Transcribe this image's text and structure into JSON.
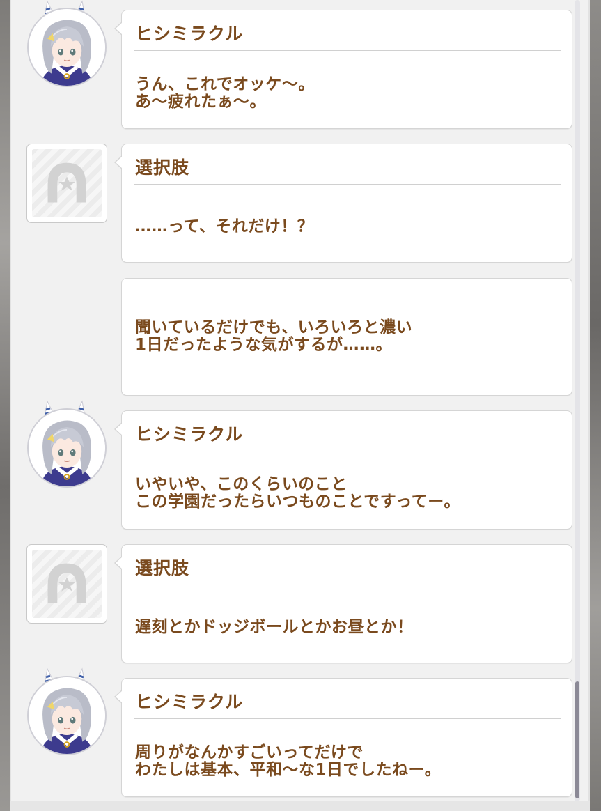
{
  "log": [
    {
      "type": "character",
      "speaker": "ヒシミラクル",
      "avatar_icon": "hishi-miracle-avatar-icon",
      "lines": "うん、これでオッケ～。\nあ～疲れたぁ～。"
    },
    {
      "type": "choice",
      "speaker": "選択肢",
      "avatar_icon": "horseshoe-star-icon",
      "lines": "……って、それだけ！？"
    },
    {
      "type": "narration",
      "speaker": "",
      "lines": "聞いているだけでも、いろいろと濃い\n1日だったような気がするが……。"
    },
    {
      "type": "character",
      "speaker": "ヒシミラクル",
      "avatar_icon": "hishi-miracle-avatar-icon",
      "lines": "いやいや、このくらいのこと\nこの学園だったらいつものことですってー。"
    },
    {
      "type": "choice",
      "speaker": "選択肢",
      "avatar_icon": "horseshoe-star-icon",
      "lines": "遅刻とかドッジボールとかお昼とか！"
    },
    {
      "type": "character",
      "speaker": "ヒシミラクル",
      "avatar_icon": "hishi-miracle-avatar-icon",
      "lines": "周りがなんかすごいってだけで\nわたしは基本、平和～な1日でしたねー。"
    }
  ],
  "colors": {
    "text": "#7a4a1e",
    "panel": "#f1f1f1",
    "bubble": "#ffffff",
    "scrollbar": "#8b8996"
  }
}
